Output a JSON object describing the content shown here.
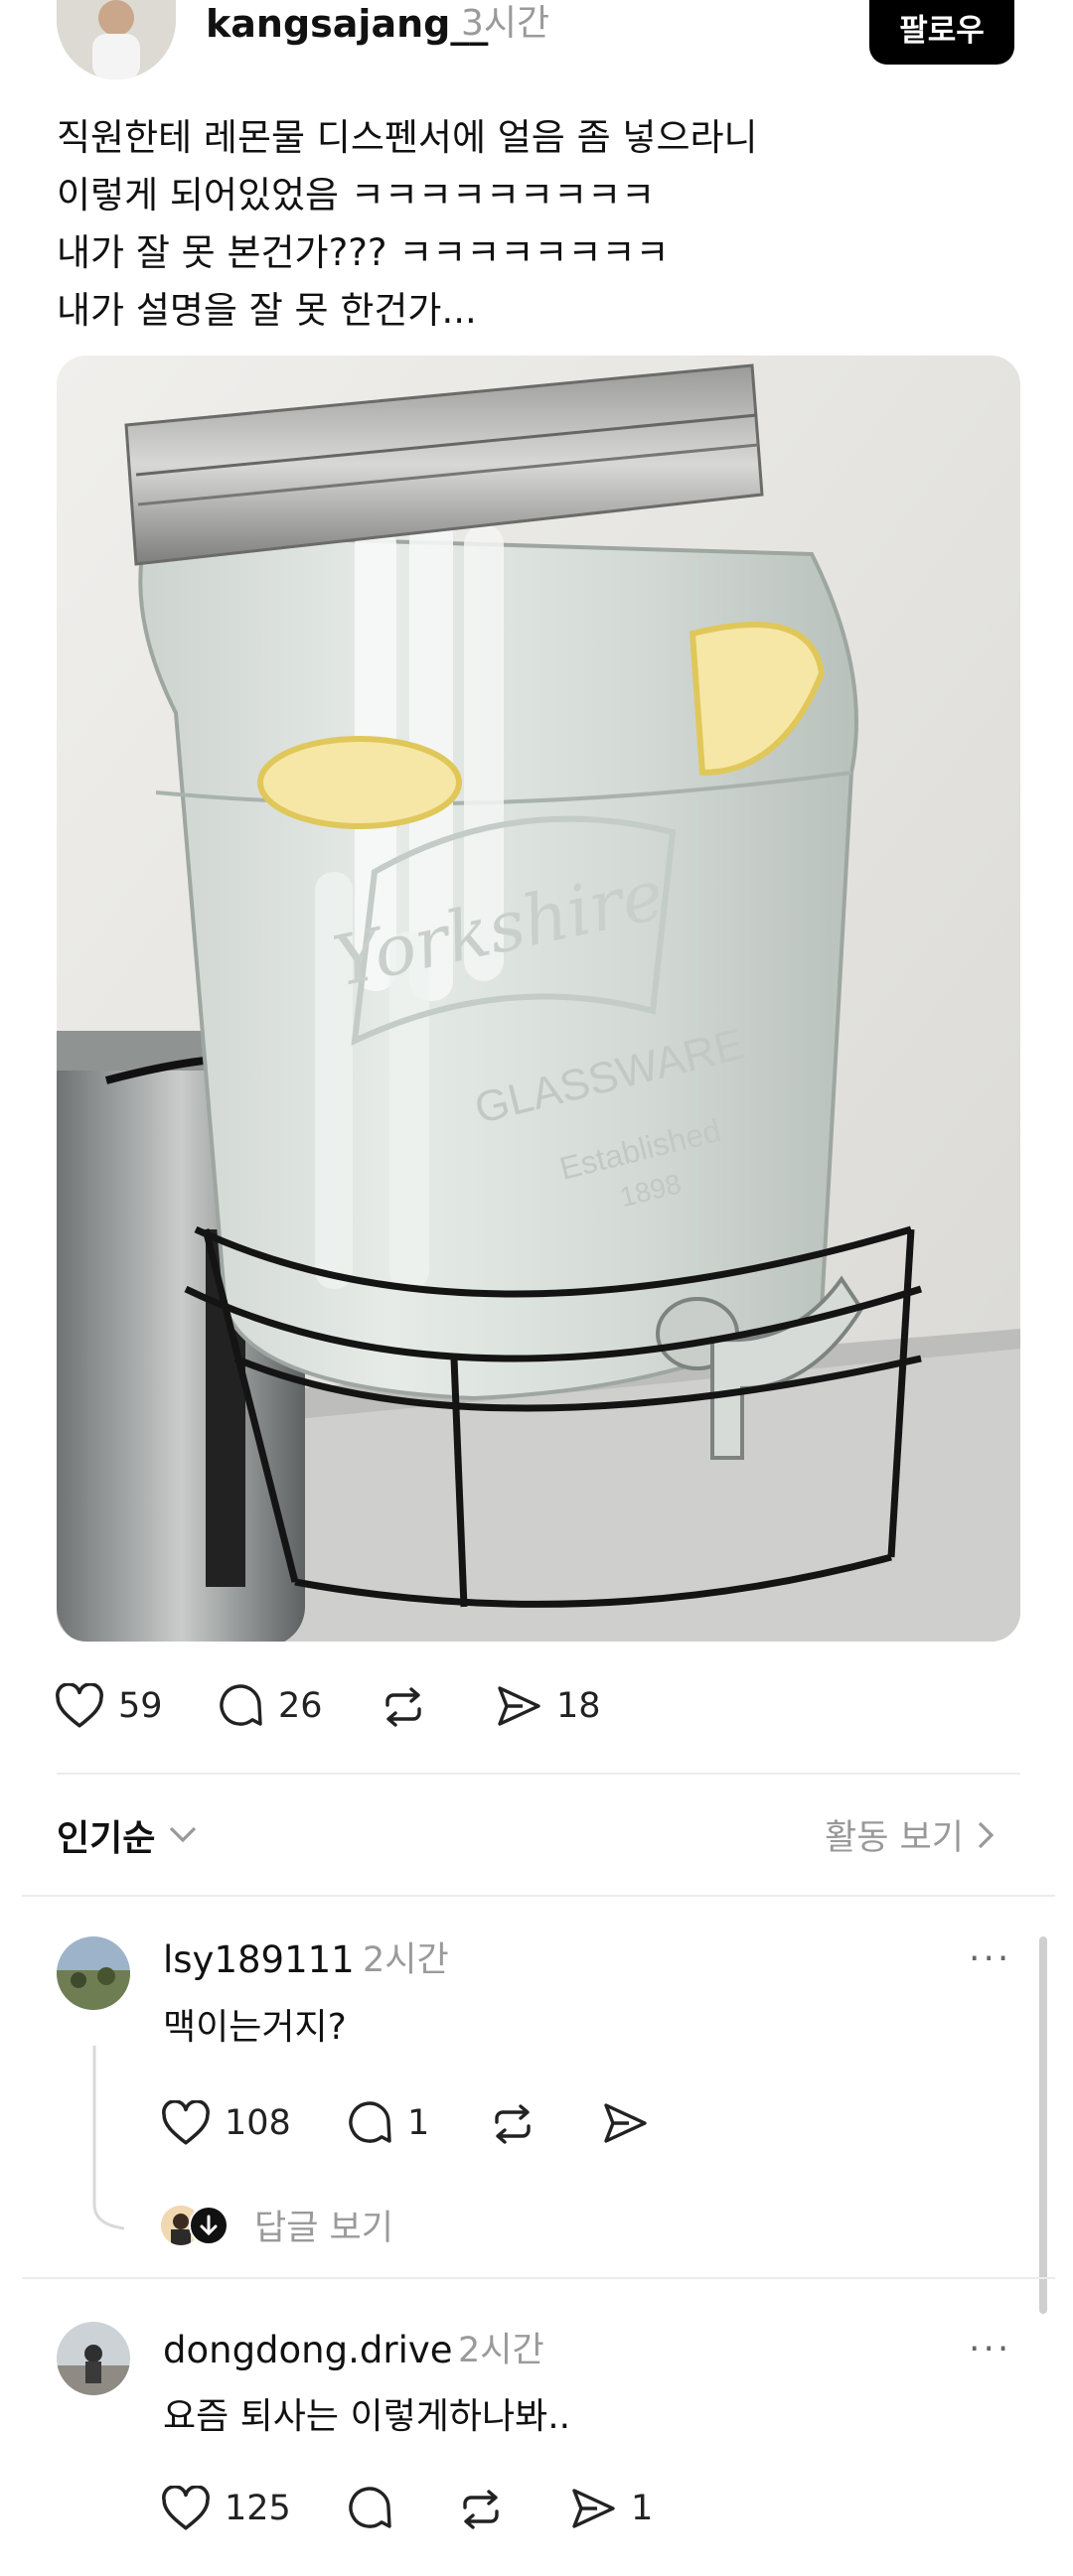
{
  "post": {
    "username": "kangsajang__",
    "time": "3시간",
    "follow_label": "팔로우",
    "lines": [
      "직원한테 레몬물 디스펜서에 얼음 좀 넣으라니",
      "이렇게 되어있었음 ㅋㅋㅋㅋㅋㅋㅋㅋㅋ",
      "내가 잘 못 본건가??? ㅋㅋㅋㅋㅋㅋㅋㅋ",
      "내가 설명을 잘 못 한건가..."
    ],
    "image": {
      "jar_text": "Yorkshire",
      "brand": "GLASSWARE",
      "established": "Established",
      "year": "1898"
    },
    "likes": "59",
    "comments": "26",
    "shares": "18"
  },
  "sort": {
    "label": "인기순",
    "activity_label": "활동 보기"
  },
  "replies": [
    {
      "username": "lsy189111",
      "time": "2시간",
      "text": "맥이는거지?",
      "likes": "108",
      "comments": "1",
      "view_replies": "답글 보기"
    },
    {
      "username": "dongdong.drive",
      "time": "2시간",
      "text": "요즘 퇴사는 이렇게하나봐..",
      "likes": "125",
      "shares": "1"
    }
  ],
  "colors": {
    "follow_bg": "#000000",
    "follow_text": "#ffffff",
    "muted": "#9a9a9a",
    "divider": "#ececec"
  }
}
